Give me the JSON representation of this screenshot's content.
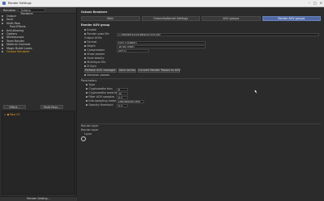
{
  "window": {
    "title": "Render Settings"
  },
  "left": {
    "renderer_label": "Renderer",
    "renderer_value": "Octane Renderer",
    "tree": [
      {
        "label": "Output",
        "checked": true
      },
      {
        "label": "Save",
        "checked": true
      },
      {
        "label": "Multi-Pass",
        "checked": false
      },
      {
        "label": "Post Effects",
        "checked": false
      },
      {
        "label": "Anti-Aliasing",
        "checked": false
      },
      {
        "label": "Options",
        "checked": false
      },
      {
        "label": "Stereoscopic",
        "checked": false
      },
      {
        "label": "Team Render",
        "checked": false
      },
      {
        "label": "Material Override",
        "checked": false
      },
      {
        "label": "Magic Bullet Looks",
        "checked": false
      },
      {
        "label": "Octane Renderer",
        "checked": false
      }
    ],
    "effect_btn": "Effect...",
    "multipass_btn": "Multi-Pass...",
    "take_label": "Take 01",
    "footer_btn": "Render Setting..."
  },
  "right": {
    "heading": "Octane Renderer",
    "tabs": [
      "Main",
      "Channels/Kernel Settings",
      "AOV groups",
      "Render AOV groups"
    ],
    "group_title": "Render AOV group",
    "enable_label": "Enable",
    "render_pass_file_label": "Render pass file",
    "render_pass_file_value": "C:/Renders/Sys/Beauty/Sys.exr",
    "output_aovs": "Output AOVs",
    "format_label": "Format",
    "format_value": "EXR (Octane)",
    "depth_label": "Depth",
    "depth_value": "16 bit (half)",
    "compression_label": "Compression",
    "compression_value": "ZIP(1)",
    "show_passes": "Show passes",
    "save_beauty": "Save beauty",
    "multilayer": "Multilayer file",
    "dlite": "D-Sync",
    "btn_refresh": "Refresh AOV manager",
    "btn_save": "Save action",
    "btn_convert": "Convert Render Passes to AOV",
    "denoiser": "Denoiser passes",
    "params_label": "Parameters",
    "p_type": "Type",
    "p_cryptomatte_bin": "Cryptomatte bins",
    "p_cryptomatte_bin_val": "6",
    "p_crypt_seed": "Cryptomatte seed factor",
    "p_crypt_seed_val": "10",
    "p_filter": "Filter AOV samples",
    "p_filter_val": "0.5",
    "p_info": "Info-sampling mode",
    "p_info_val": "Distributed rays",
    "p_cutoff": "Opacity threshold",
    "p_cutoff_val": "0.5",
    "render_layer": "Render layer",
    "render_layer_group": "Render layer",
    "layer_note": "Layer"
  }
}
